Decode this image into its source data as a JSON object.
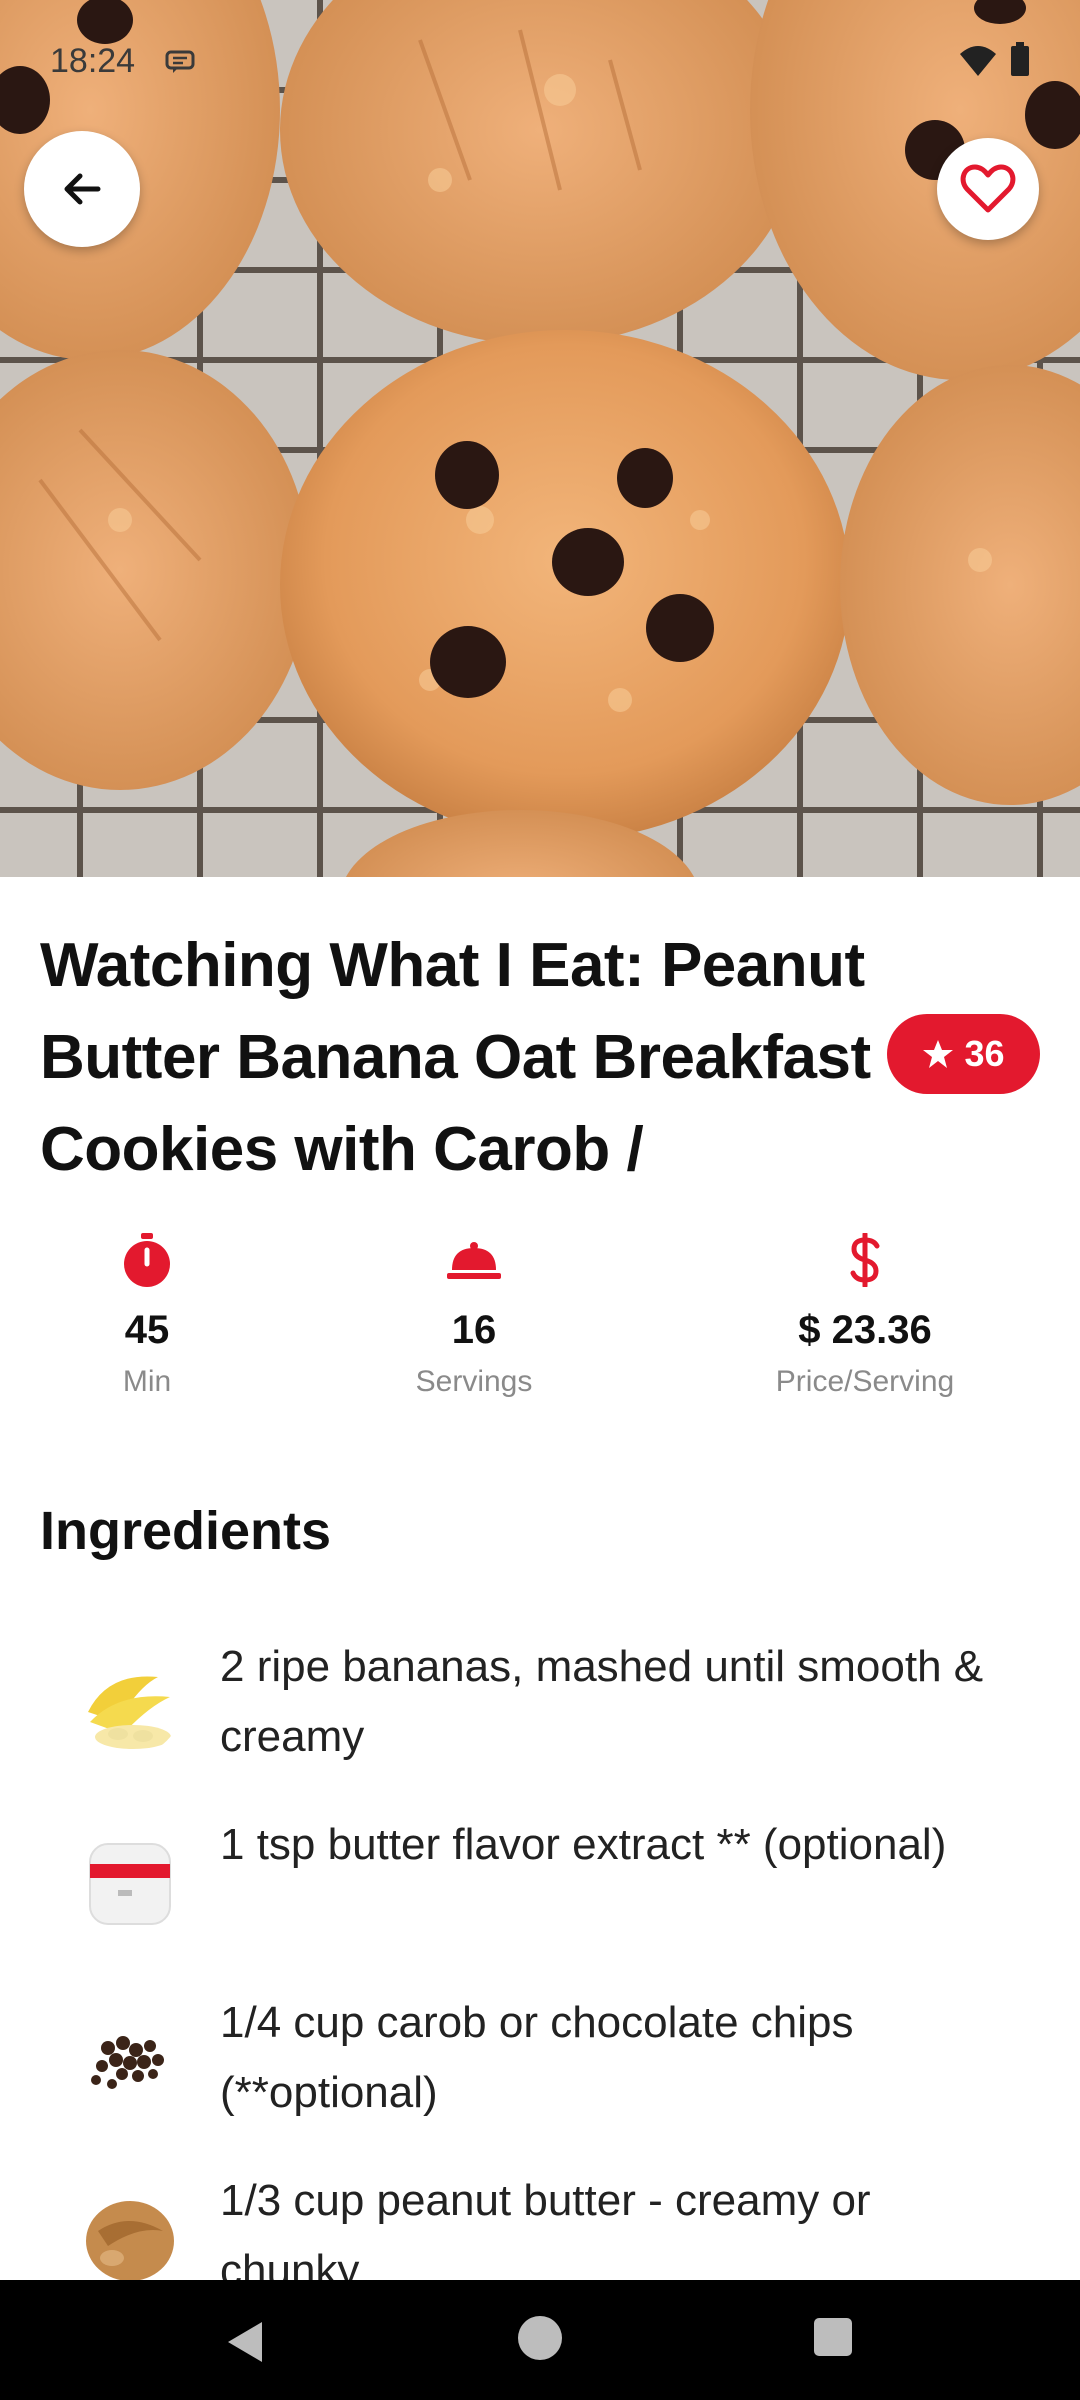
{
  "status_bar": {
    "time": "18:24"
  },
  "hero": {
    "image_subject": "peanut butter banana oat cookies on cooling rack"
  },
  "recipe": {
    "title": "Watching What I Eat: Peanut Butter Banana Oat Breakfast Cookies with Carob /",
    "rating": "36"
  },
  "stats": [
    {
      "icon": "timer-icon",
      "value": "45",
      "label": "Min"
    },
    {
      "icon": "cloche-icon",
      "value": "16",
      "label": "Servings"
    },
    {
      "icon": "dollar-icon",
      "value": "$ 23.36",
      "label": "Price/Serving"
    }
  ],
  "ingredients_title": "Ingredients",
  "ingredients": [
    {
      "text": "2 ripe bananas, mashed until smooth & creamy",
      "thumb": "bananas"
    },
    {
      "text": "1 tsp butter flavor extract ** (optional)",
      "thumb": "extract-jar"
    },
    {
      "text": "1/4 cup carob or chocolate chips (**optional)",
      "thumb": "chocolate-chips"
    },
    {
      "text": "1/3 cup peanut butter - creamy or chunky",
      "thumb": "peanut-butter"
    }
  ],
  "colors": {
    "accent": "#e3192e",
    "text": "#111111",
    "muted": "#8a8a8a"
  }
}
